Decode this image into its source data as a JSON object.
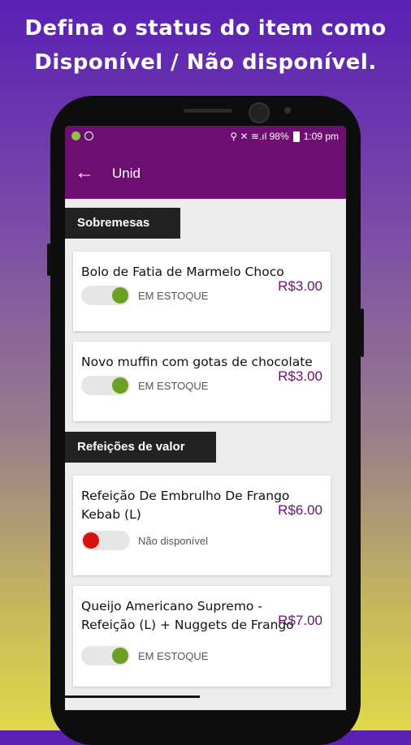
{
  "promo": {
    "line1": "Defina o status do item como",
    "line2": "Disponível / Não disponível."
  },
  "statusbar": {
    "right_text": "⚲ ✕ ≋.ıl 98%",
    "time": "1:09 pm"
  },
  "appbar": {
    "back_icon": "←",
    "title": "Unid"
  },
  "colors": {
    "primary": "#6f0e72",
    "on": "#6aa121",
    "off": "#d81010"
  },
  "sections": [
    {
      "title": "Sobremesas",
      "items": [
        {
          "name": "Bolo de Fatia de Marmelo Choco",
          "price": "R$3.00",
          "status": "EM ESTOQUE",
          "available": true
        },
        {
          "name": "Novo muffin com gotas de chocolate",
          "price": "R$3.00",
          "status": "EM ESTOQUE",
          "available": true
        }
      ]
    },
    {
      "title": "Refeições de valor",
      "items": [
        {
          "name": "Refeição De Embrulho De Frango Kebab (L)",
          "price": "R$6.00",
          "status": "Não disponível",
          "available": false
        },
        {
          "name": "Queijo Americano Supremo - Refeição (L) + Nuggets de Frango",
          "price": "R$7.00",
          "status": "EM ESTOQUE",
          "available": true
        }
      ]
    }
  ]
}
